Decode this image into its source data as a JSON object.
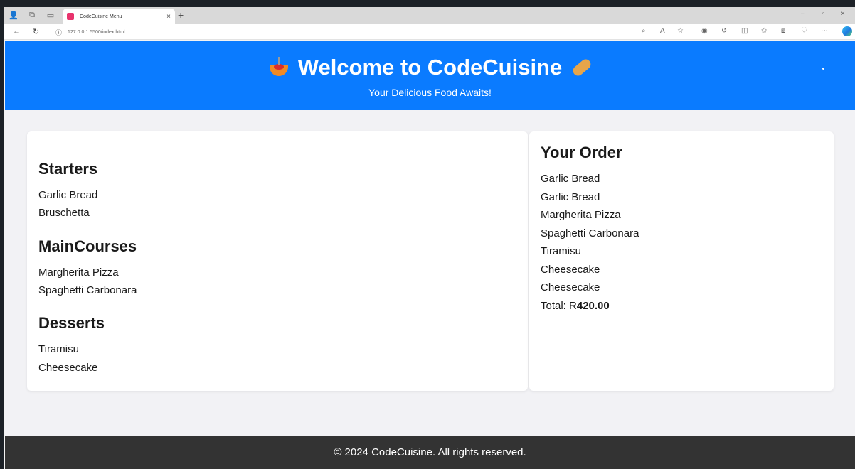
{
  "browser": {
    "tab_title": "CodeCuisine Menu",
    "tab_close": "×",
    "new_tab": "+",
    "url": "127.0.0.1:5500/index.html",
    "minimize": "–",
    "restore": "▫",
    "close": "×"
  },
  "header": {
    "title": "Welcome to CodeCuisine",
    "tagline": "Your Delicious Food Awaits!",
    "brand_color": "#0a7bff"
  },
  "menu": {
    "categories": [
      {
        "title": "Starters",
        "items": [
          "Garlic Bread",
          "Bruschetta"
        ]
      },
      {
        "title": "MainCourses",
        "items": [
          "Margherita Pizza",
          "Spaghetti Carbonara"
        ]
      },
      {
        "title": "Desserts",
        "items": [
          "Tiramisu",
          "Cheesecake"
        ]
      }
    ]
  },
  "order": {
    "title": "Your Order",
    "items": [
      "Garlic Bread",
      "Garlic Bread",
      "Margherita Pizza",
      "Spaghetti Carbonara",
      "Tiramisu",
      "Cheesecake",
      "Cheesecake"
    ],
    "total_label": "Total: R",
    "total_value": "420.00"
  },
  "footer": {
    "text": "© 2024 CodeCuisine. All rights reserved."
  }
}
